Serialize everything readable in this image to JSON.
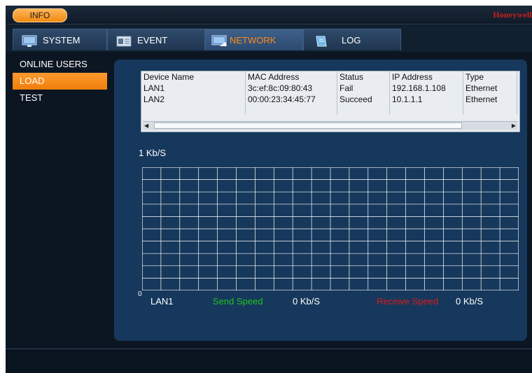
{
  "top": {
    "info_label": "INFO",
    "brand": "Honeywell"
  },
  "tabs": [
    {
      "label": "SYSTEM",
      "icon": "monitor-icon"
    },
    {
      "label": "EVENT",
      "icon": "event-icon"
    },
    {
      "label": "NETWORK",
      "icon": "network-icon"
    },
    {
      "label": "LOG",
      "icon": "log-icon"
    }
  ],
  "sidebar": {
    "items": [
      {
        "label": "ONLINE USERS"
      },
      {
        "label": "LOAD"
      },
      {
        "label": "TEST"
      }
    ]
  },
  "table": {
    "headers": [
      "Device Name",
      "MAC Address",
      "Status",
      "IP Address",
      "Type"
    ],
    "rows": [
      [
        "LAN1",
        "3c:ef:8c:09:80:43",
        "Fail",
        "192.168.1.108",
        "Ethernet"
      ],
      [
        "LAN2",
        "00:00:23:34:45:77",
        "Succeed",
        "10.1.1.1",
        "Ethernet"
      ]
    ]
  },
  "load": {
    "unit_label": "1 Kb/S",
    "zero_label": "0",
    "device": "LAN1",
    "send_label": "Send Speed",
    "send_value": "0 Kb/S",
    "receive_label": "Receive Speed",
    "receive_value": "0 Kb/S"
  },
  "colors": {
    "accent": "#ef7e0c",
    "send": "#1fc21f",
    "receive": "#d81c1c"
  }
}
